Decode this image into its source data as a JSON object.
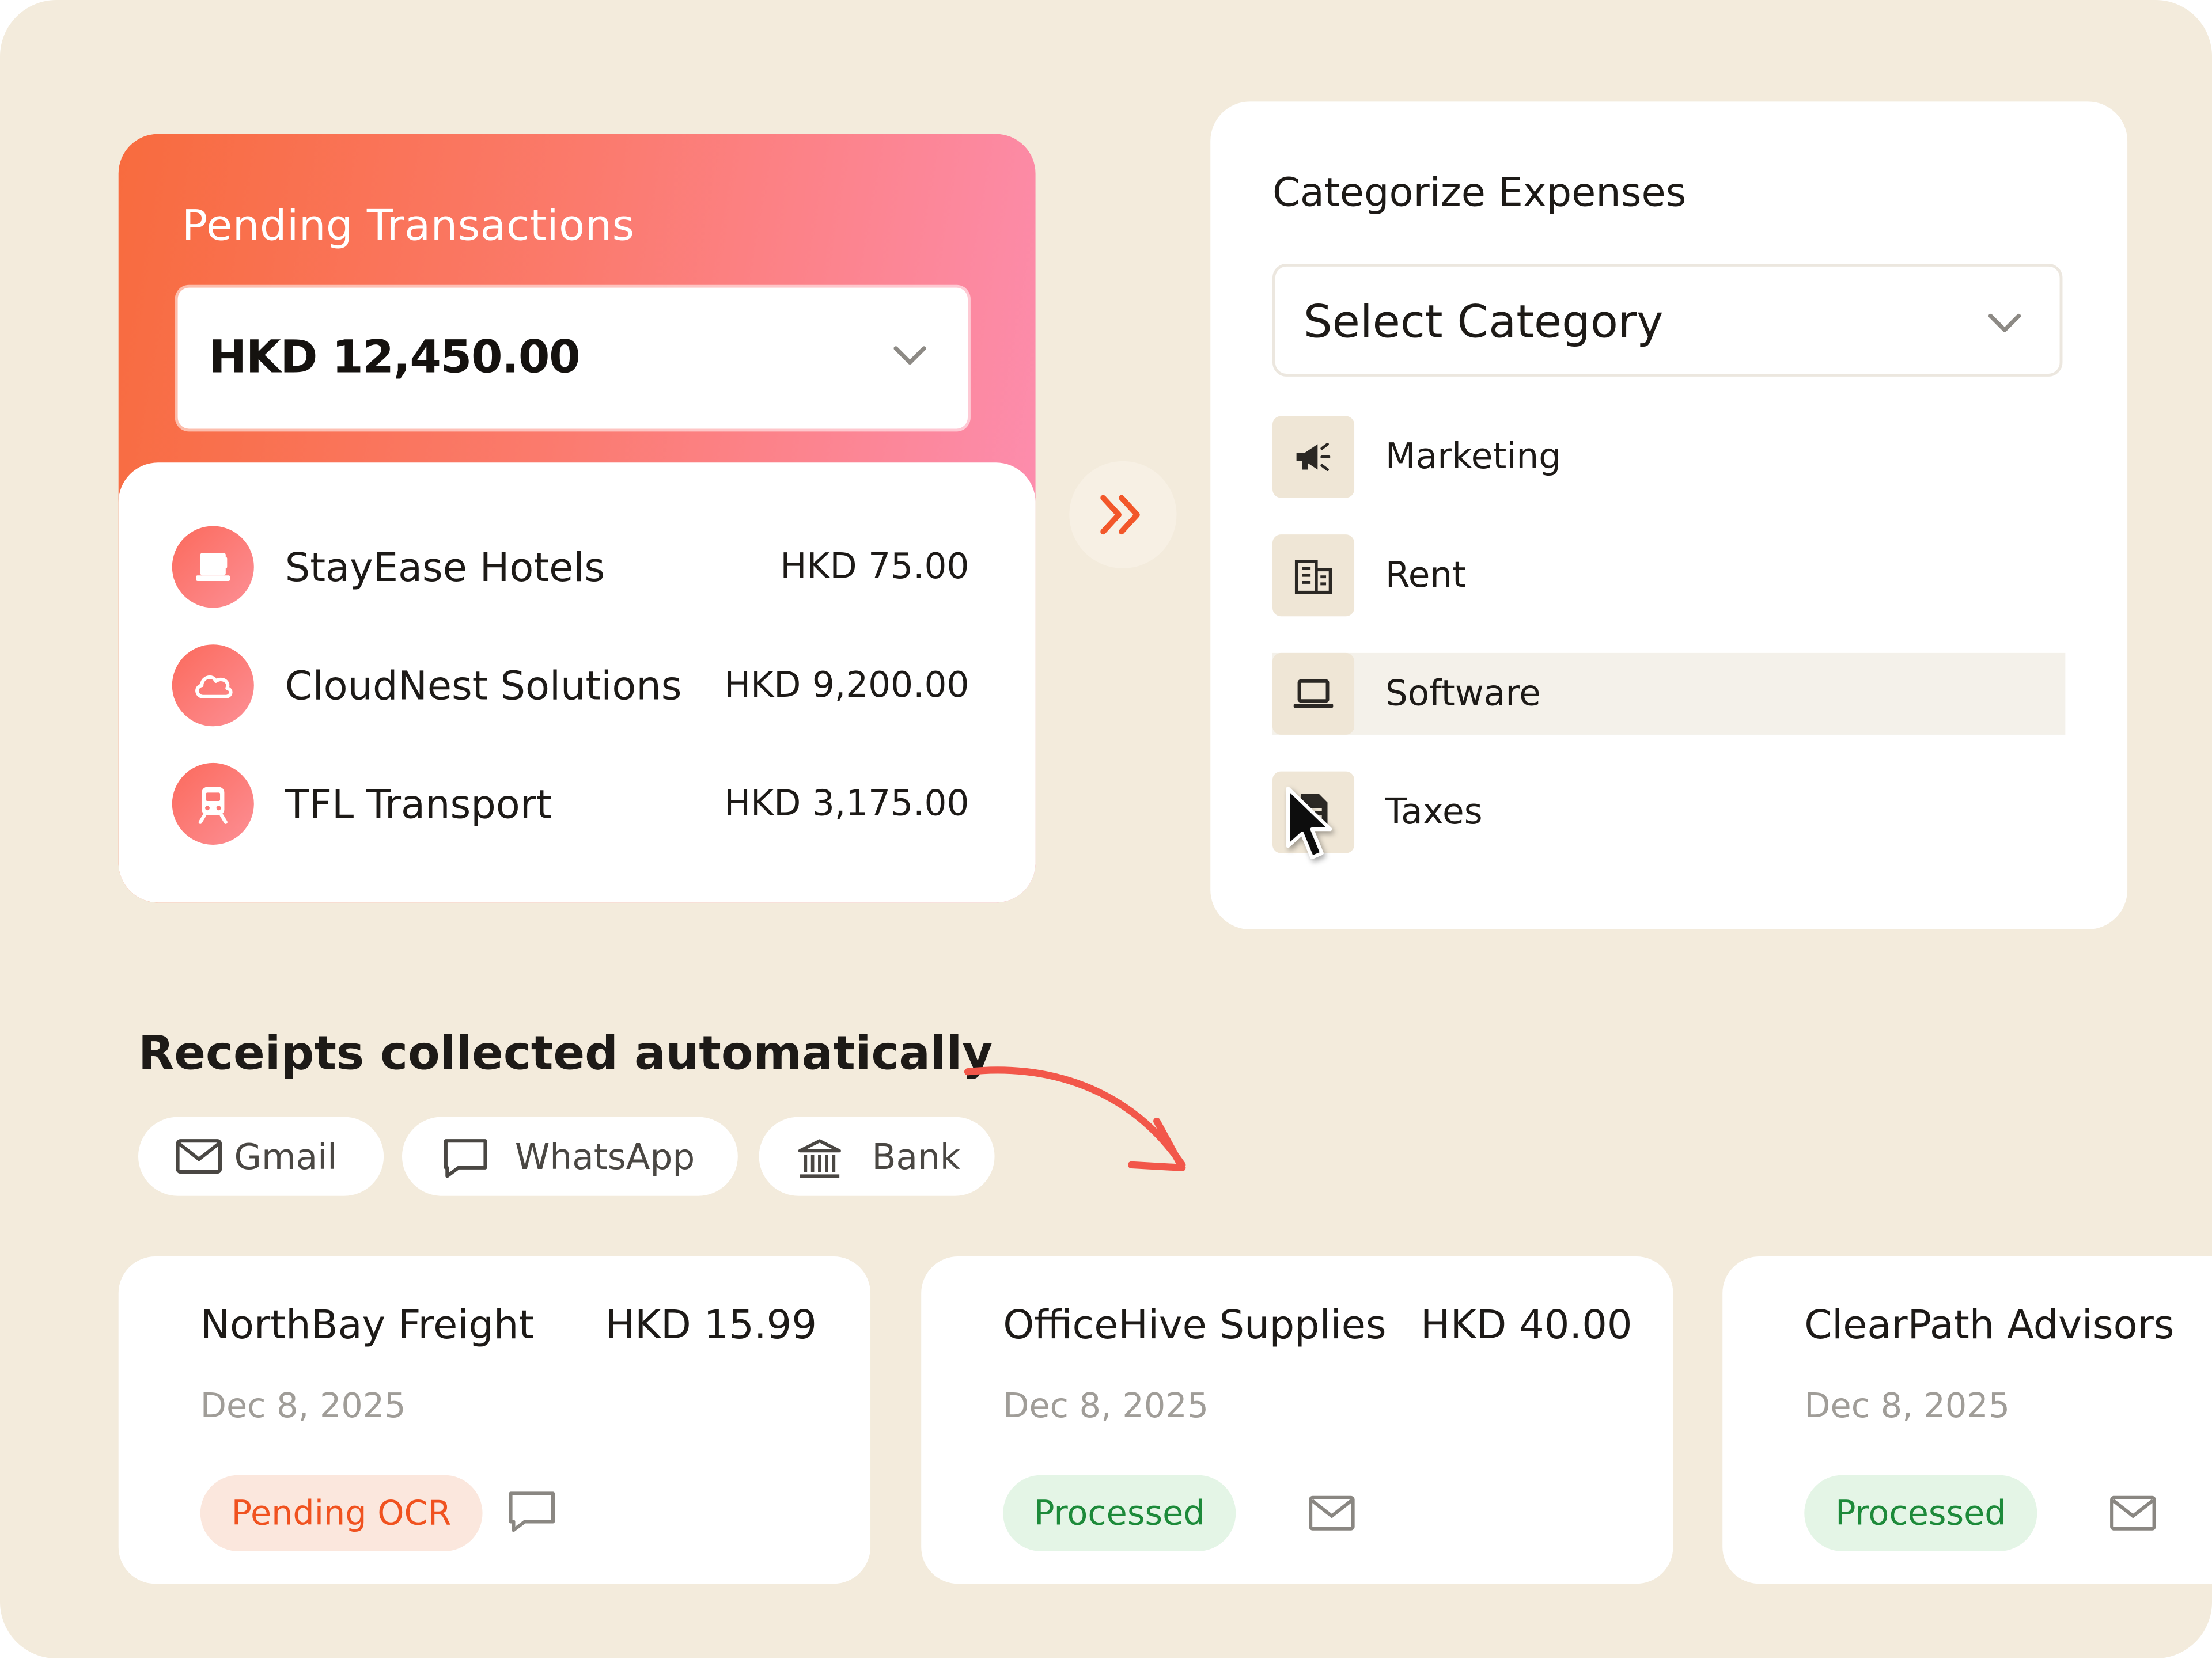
{
  "pending": {
    "title": "Pending Transactions",
    "amount": "HKD 12,450.00",
    "transactions": [
      {
        "name": "StayEase Hotels",
        "amount": "HKD 75.00",
        "icon": "hotel-icon"
      },
      {
        "name": "CloudNest Solutions",
        "amount": "HKD 9,200.00",
        "icon": "cloud-icon"
      },
      {
        "name": "TFL Transport",
        "amount": "HKD 3,175.00",
        "icon": "train-icon"
      }
    ]
  },
  "categorize": {
    "title": "Categorize Expenses",
    "select_placeholder": "Select Category",
    "options": [
      {
        "label": "Marketing",
        "icon": "megaphone-icon"
      },
      {
        "label": "Rent",
        "icon": "building-icon"
      },
      {
        "label": "Software",
        "icon": "laptop-icon",
        "selected": true
      },
      {
        "label": "Taxes",
        "icon": "document-icon"
      }
    ]
  },
  "receipts": {
    "title": "Receipts collected automatically",
    "sources": [
      {
        "label": "Gmail",
        "icon": "mail-icon"
      },
      {
        "label": "WhatsApp",
        "icon": "chat-icon"
      },
      {
        "label": "Bank",
        "icon": "bank-icon"
      }
    ],
    "cards": [
      {
        "vendor": "NorthBay Freight",
        "amount": "HKD 15.99",
        "date": "Dec 8, 2025",
        "status": "Pending OCR",
        "source_icon": "chat-icon"
      },
      {
        "vendor": "OfficeHive Supplies",
        "amount": "HKD 40.00",
        "date": "Dec 8, 2025",
        "status": "Processed",
        "source_icon": "mail-icon"
      },
      {
        "vendor": "ClearPath Advisors",
        "amount": "",
        "date": "Dec 8, 2025",
        "status": "Processed",
        "source_icon": "mail-icon"
      }
    ]
  },
  "colors": {
    "background": "#f3ebdc",
    "accent": "#f86b3e",
    "pending_badge": "#f0521f",
    "processed_badge": "#1d8a3a"
  }
}
